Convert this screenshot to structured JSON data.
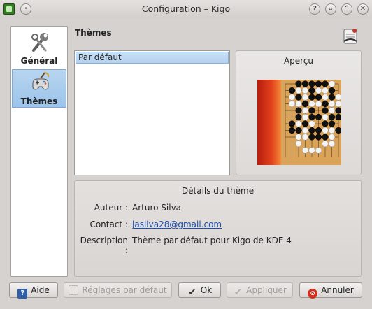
{
  "window": {
    "title": "Configuration – Kigo",
    "buttons": [
      "?",
      "⌄",
      "⌃",
      "✕"
    ]
  },
  "sidebar": {
    "items": [
      {
        "label": "Général",
        "icon": "tools-icon",
        "active": false
      },
      {
        "label": "Thèmes",
        "icon": "game-theme-icon",
        "active": true
      }
    ]
  },
  "page": {
    "title": "Thèmes"
  },
  "theme_list": {
    "items": [
      "Par défaut"
    ],
    "selected": "Par défaut"
  },
  "preview": {
    "title": "Aperçu"
  },
  "details": {
    "title": "Détails du thème",
    "author_label": "Auteur :",
    "author": "Arturo Silva",
    "contact_label": "Contact :",
    "contact": "jasilva28@gmail.com",
    "description_label": "Description :",
    "description": "Thème par défaut pour Kigo de KDE 4"
  },
  "buttons": {
    "help": "Aide",
    "defaults": "Réglages par défaut",
    "ok": "Ok",
    "apply": "Appliquer",
    "cancel": "Annuler"
  },
  "colors": {
    "selection": "#b3d1ef",
    "board": "#d9a45a",
    "board_side": "#d0391e",
    "link": "#1a4fb5"
  }
}
